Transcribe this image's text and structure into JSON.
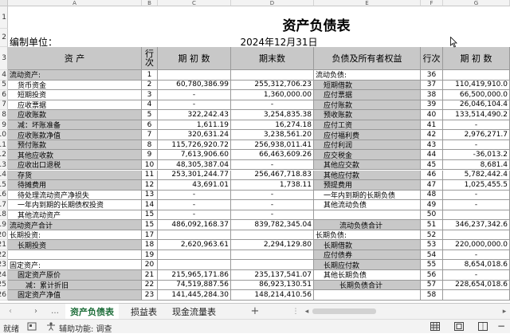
{
  "columns": [
    "A",
    "B",
    "C",
    "D",
    "E",
    "F",
    "G"
  ],
  "rows_numbers": [
    "1",
    "2",
    "3",
    "4",
    "5",
    "6",
    "7",
    "8",
    "9",
    "10",
    "11",
    "12",
    "13",
    "14",
    "15",
    "16",
    "17",
    "18",
    "19",
    "20",
    "21",
    "22",
    "23",
    "24",
    "25",
    "26"
  ],
  "title": "资产负债表",
  "unit_label": "编制单位：",
  "report_date": "2024年12月31日",
  "headers": {
    "asset": "资        产",
    "line": "行\n次",
    "opening": "期 初 数",
    "closing": "期末数",
    "liab": "负债及所有者权益",
    "line2": "行次",
    "opening2": "期 初 数"
  },
  "left_rows": [
    {
      "name": "流动资产:",
      "line": "1",
      "open": "",
      "close": "",
      "gray": true,
      "indent": 0
    },
    {
      "name": "货币资金",
      "line": "2",
      "open": "60,780,386.99",
      "close": "255,312,706.23",
      "gray": false,
      "indent": 1
    },
    {
      "name": "短期投资",
      "line": "3",
      "open": "-",
      "close": "1,360,000.00",
      "gray": false,
      "indent": 1
    },
    {
      "name": "应收票据",
      "line": "4",
      "open": "-",
      "close": "-",
      "gray": false,
      "indent": 1
    },
    {
      "name": "应收账款",
      "line": "5",
      "open": "322,242.43",
      "close": "3,254,835.38",
      "gray": true,
      "indent": 1
    },
    {
      "name": "减：坏账准备",
      "line": "6",
      "open": "1,611.19",
      "close": "16,274.18",
      "gray": true,
      "indent": 1
    },
    {
      "name": "应收账款净值",
      "line": "7",
      "open": "320,631.24",
      "close": "3,238,561.20",
      "gray": true,
      "indent": 1
    },
    {
      "name": "预付账款",
      "line": "8",
      "open": "115,726,920.72",
      "close": "256,938,011.41",
      "gray": true,
      "indent": 1
    },
    {
      "name": "其他应收款",
      "line": "9",
      "open": "7,613,906.60",
      "close": "66,463,609.26",
      "gray": true,
      "indent": 1
    },
    {
      "name": "应收出口退税",
      "line": "10",
      "open": "48,305,387.04",
      "close": "-",
      "gray": true,
      "indent": 1
    },
    {
      "name": "存货",
      "line": "11",
      "open": "253,301,244.77",
      "close": "256,467,718.83",
      "gray": true,
      "indent": 1
    },
    {
      "name": "待摊费用",
      "line": "12",
      "open": "43,691.01",
      "close": "1,738.11",
      "gray": true,
      "indent": 1
    },
    {
      "name": "待处理流动资产净损失",
      "line": "13",
      "open": "-",
      "close": "-",
      "gray": false,
      "indent": 1
    },
    {
      "name": "一年内到期的长期债权投资",
      "line": "14",
      "open": "-",
      "close": "-",
      "gray": false,
      "indent": 1
    },
    {
      "name": "其他流动资产",
      "line": "15",
      "open": "-",
      "close": "-",
      "gray": false,
      "indent": 1
    },
    {
      "name": "流动资产合计",
      "line": "15",
      "open": "486,092,168.37",
      "close": "839,782,345.04",
      "gray": true,
      "indent": 0
    },
    {
      "name": "长期投资:",
      "line": "17",
      "open": "",
      "close": "",
      "gray": false,
      "indent": 0
    },
    {
      "name": "长期投资",
      "line": "18",
      "open": "2,620,963.61",
      "close": "2,294,129.80",
      "gray": true,
      "indent": 1
    },
    {
      "name": "",
      "line": "19",
      "open": "",
      "close": "",
      "gray": false,
      "indent": 0
    },
    {
      "name": "固定资产:",
      "line": "20",
      "open": "",
      "close": "",
      "gray": false,
      "indent": 0
    },
    {
      "name": "固定资产原价",
      "line": "21",
      "open": "215,965,171.86",
      "close": "235,137,541.07",
      "gray": true,
      "indent": 1
    },
    {
      "name": "减：累计折旧",
      "line": "22",
      "open": "74,519,887.56",
      "close": "86,923,130.51",
      "gray": true,
      "indent": 2
    },
    {
      "name": "固定资产净值",
      "line": "23",
      "open": "141,445,284.30",
      "close": "148,214,410.56",
      "gray": true,
      "indent": 1
    }
  ],
  "right_rows": [
    {
      "name": "流动负债:",
      "line": "36",
      "open": "",
      "gray": false,
      "indent": 0
    },
    {
      "name": "短期借款",
      "line": "37",
      "open": "110,419,910.0",
      "gray": true,
      "indent": 1
    },
    {
      "name": "应付票据",
      "line": "38",
      "open": "66,500,000.0",
      "gray": true,
      "indent": 1
    },
    {
      "name": "应付账款",
      "line": "39",
      "open": "26,046,104.4",
      "gray": true,
      "indent": 1
    },
    {
      "name": "预收账款",
      "line": "40",
      "open": "133,514,490.2",
      "gray": true,
      "indent": 1
    },
    {
      "name": "应付工资",
      "line": "41",
      "open": "-",
      "gray": true,
      "indent": 1
    },
    {
      "name": "应付福利费",
      "line": "42",
      "open": "2,976,271.7",
      "gray": true,
      "indent": 1
    },
    {
      "name": "应付利润",
      "line": "43",
      "open": "-",
      "gray": true,
      "indent": 1
    },
    {
      "name": "应交税金",
      "line": "44",
      "open": "-36,013.2",
      "gray": true,
      "indent": 1
    },
    {
      "name": "其他应交款",
      "line": "45",
      "open": "8,681.4",
      "gray": true,
      "indent": 1
    },
    {
      "name": "其他应付款",
      "line": "46",
      "open": "5,782,442.4",
      "gray": true,
      "indent": 1
    },
    {
      "name": "预提费用",
      "line": "47",
      "open": "1,025,455.5",
      "gray": true,
      "indent": 1
    },
    {
      "name": "一年内到期的长期负债",
      "line": "48",
      "open": "-",
      "gray": false,
      "indent": 1
    },
    {
      "name": "其他流动负债",
      "line": "49",
      "open": "-",
      "gray": false,
      "indent": 1
    },
    {
      "name": "",
      "line": "50",
      "open": "",
      "gray": false,
      "indent": 0
    },
    {
      "name": "流动负债合计",
      "line": "51",
      "open": "346,237,342.6",
      "gray": true,
      "indent": 3
    },
    {
      "name": "长期负债:",
      "line": "52",
      "open": "",
      "gray": false,
      "indent": 0
    },
    {
      "name": "长期借款",
      "line": "53",
      "open": "220,000,000.0",
      "gray": true,
      "indent": 1
    },
    {
      "name": "应付债券",
      "line": "54",
      "open": "-",
      "gray": true,
      "indent": 1
    },
    {
      "name": "长期应付款",
      "line": "55",
      "open": "8,654,018.6",
      "gray": true,
      "indent": 1
    },
    {
      "name": "其他长期负债",
      "line": "56",
      "open": "-",
      "gray": false,
      "indent": 1
    },
    {
      "name": "长期负债合计",
      "line": "57",
      "open": "228,654,018.6",
      "gray": true,
      "indent": 3
    },
    {
      "name": "",
      "line": "58",
      "open": "",
      "gray": false,
      "indent": 0
    }
  ],
  "tabs": [
    "资产负债表",
    "损益表",
    "现金流量表"
  ],
  "status": {
    "ready": "就绪",
    "accessibility": "辅助功能: 调查"
  }
}
